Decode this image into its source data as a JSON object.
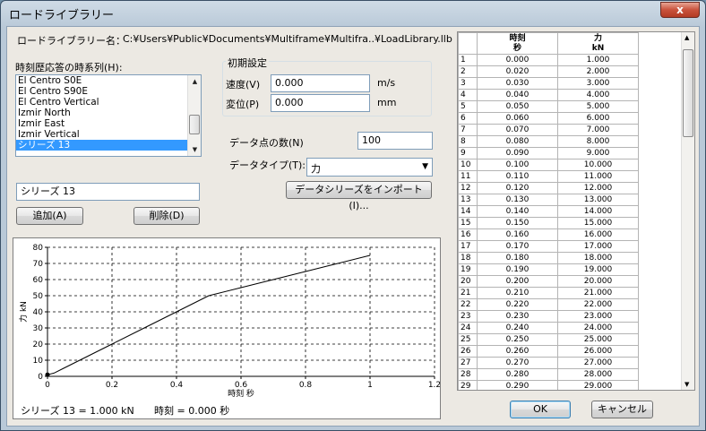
{
  "window": {
    "title": "ロードライブラリー",
    "close_glyph": "x"
  },
  "library": {
    "label": "ロードライブラリー名：",
    "path": "C:¥Users¥Public¥Documents¥Multiframe¥Multifra..¥LoadLibrary.llb"
  },
  "series_list": {
    "label": "時刻歴応答の時系列(H):",
    "items": [
      "El Centro S0E",
      "El Centro S90E",
      "El Centro Vertical",
      "Izmir North",
      "Izmir East",
      "Izmir Vertical",
      "シリーズ 13"
    ],
    "selected_index": 6
  },
  "initial": {
    "group_label": "初期設定",
    "velocity_label": "速度(V)",
    "velocity_value": "0.000",
    "velocity_unit": "m/s",
    "displacement_label": "変位(P)",
    "displacement_value": "0.000",
    "displacement_unit": "mm"
  },
  "data_points": {
    "label": "データ点の数(N)",
    "value": "100"
  },
  "data_type": {
    "label": "データタイプ(T):",
    "value": "力"
  },
  "import_button": "データシリーズをインポート(I)...",
  "name_field": {
    "value": "シリーズ 13"
  },
  "add_button": "追加(A)",
  "delete_button": "削除(D)",
  "status": {
    "series": "シリーズ 13 =  1.000 kN",
    "time": "時刻 =  0.000 秒"
  },
  "buttons": {
    "ok": "OK",
    "cancel": "キャンセル"
  },
  "table": {
    "headers": [
      [
        "時刻",
        "秒"
      ],
      [
        "力",
        "kN"
      ]
    ],
    "rows": [
      [
        "1",
        "0.000",
        "1.000"
      ],
      [
        "2",
        "0.020",
        "2.000"
      ],
      [
        "3",
        "0.030",
        "3.000"
      ],
      [
        "4",
        "0.040",
        "4.000"
      ],
      [
        "5",
        "0.050",
        "5.000"
      ],
      [
        "6",
        "0.060",
        "6.000"
      ],
      [
        "7",
        "0.070",
        "7.000"
      ],
      [
        "8",
        "0.080",
        "8.000"
      ],
      [
        "9",
        "0.090",
        "9.000"
      ],
      [
        "10",
        "0.100",
        "10.000"
      ],
      [
        "11",
        "0.110",
        "11.000"
      ],
      [
        "12",
        "0.120",
        "12.000"
      ],
      [
        "13",
        "0.130",
        "13.000"
      ],
      [
        "14",
        "0.140",
        "14.000"
      ],
      [
        "15",
        "0.150",
        "15.000"
      ],
      [
        "16",
        "0.160",
        "16.000"
      ],
      [
        "17",
        "0.170",
        "17.000"
      ],
      [
        "18",
        "0.180",
        "18.000"
      ],
      [
        "19",
        "0.190",
        "19.000"
      ],
      [
        "20",
        "0.200",
        "20.000"
      ],
      [
        "21",
        "0.210",
        "21.000"
      ],
      [
        "22",
        "0.220",
        "22.000"
      ],
      [
        "23",
        "0.230",
        "23.000"
      ],
      [
        "24",
        "0.240",
        "24.000"
      ],
      [
        "25",
        "0.250",
        "25.000"
      ],
      [
        "26",
        "0.260",
        "26.000"
      ],
      [
        "27",
        "0.270",
        "27.000"
      ],
      [
        "28",
        "0.280",
        "28.000"
      ],
      [
        "29",
        "0.290",
        "29.000"
      ]
    ]
  },
  "chart_data": {
    "type": "line",
    "xlabel": "時刻  秒",
    "ylabel": "力  kN",
    "xlim": [
      0,
      1.2
    ],
    "ylim": [
      0,
      80
    ],
    "xticks": [
      "0",
      "0.2",
      "0.4",
      "0.6",
      "0.8",
      "1",
      "1.2"
    ],
    "yticks": [
      "0",
      "10",
      "20",
      "30",
      "40",
      "50",
      "60",
      "70",
      "80"
    ],
    "grid": true,
    "x": [
      0,
      0.02,
      0.05,
      0.1,
      0.2,
      0.3,
      0.4,
      0.5,
      0.6,
      0.7,
      0.8,
      0.9,
      1.0
    ],
    "y": [
      1,
      2,
      5,
      10,
      20,
      30,
      40,
      50,
      55,
      60,
      65,
      70,
      75
    ],
    "marker_point": [
      0,
      1
    ]
  }
}
